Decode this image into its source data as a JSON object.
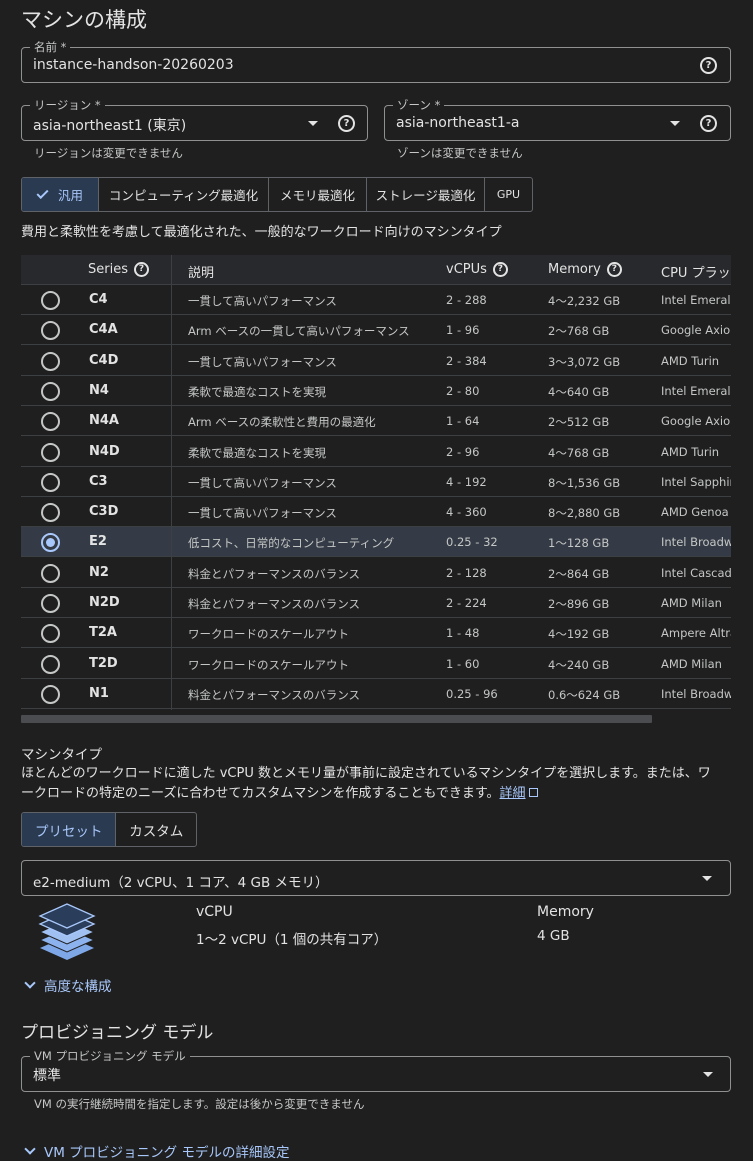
{
  "page": {
    "title": "マシンの構成"
  },
  "name_field": {
    "label": "名前 *",
    "value": "instance-handson-20260203"
  },
  "region_field": {
    "label": "リージョン *",
    "value": "asia-northeast1 (東京)",
    "hint": "リージョンは変更できません"
  },
  "zone_field": {
    "label": "ゾーン *",
    "value": "asia-northeast1-a",
    "hint": "ゾーンは変更できません"
  },
  "family_tabs": {
    "items": [
      {
        "label": "汎用",
        "selected": true
      },
      {
        "label": "コンピューティング最適化",
        "selected": false
      },
      {
        "label": "メモリ最適化",
        "selected": false
      },
      {
        "label": "ストレージ最適化",
        "selected": false
      },
      {
        "label": "GPU",
        "selected": false
      }
    ],
    "description": "費用と柔軟性を考慮して最適化された、一般的なワークロード向けのマシンタイプ"
  },
  "series_table": {
    "columns": [
      "Series",
      "説明",
      "vCPUs",
      "Memory",
      "CPU プラットフォーム"
    ],
    "rows": [
      {
        "series": "C4",
        "description": "一貫して高いパフォーマンス",
        "vcpus": "2 - 288",
        "memory": "4～2,232 GB",
        "cpu": "Intel Emerald Rapids",
        "selected": false
      },
      {
        "series": "C4A",
        "description": "Arm ベースの一貫して高いパフォーマンス",
        "vcpus": "1 - 96",
        "memory": "2～768 GB",
        "cpu": "Google Axion",
        "selected": false
      },
      {
        "series": "C4D",
        "description": "一貫して高いパフォーマンス",
        "vcpus": "2 - 384",
        "memory": "3～3,072 GB",
        "cpu": "AMD Turin",
        "selected": false
      },
      {
        "series": "N4",
        "description": "柔軟で最適なコストを実現",
        "vcpus": "2 - 80",
        "memory": "4～640 GB",
        "cpu": "Intel Emerald Rapids",
        "selected": false
      },
      {
        "series": "N4A",
        "description": "Arm ベースの柔軟性と費用の最適化",
        "vcpus": "1 - 64",
        "memory": "2～512 GB",
        "cpu": "Google Axion",
        "selected": false
      },
      {
        "series": "N4D",
        "description": "柔軟で最適なコストを実現",
        "vcpus": "2 - 96",
        "memory": "4～768 GB",
        "cpu": "AMD Turin",
        "selected": false
      },
      {
        "series": "C3",
        "description": "一貫して高いパフォーマンス",
        "vcpus": "4 - 192",
        "memory": "8～1,536 GB",
        "cpu": "Intel Sapphire Rapids",
        "selected": false
      },
      {
        "series": "C3D",
        "description": "一貫して高いパフォーマンス",
        "vcpus": "4 - 360",
        "memory": "8～2,880 GB",
        "cpu": "AMD Genoa",
        "selected": false
      },
      {
        "series": "E2",
        "description": "低コスト、日常的なコンピューティング",
        "vcpus": "0.25 - 32",
        "memory": "1～128 GB",
        "cpu": "Intel Broadwell",
        "selected": true
      },
      {
        "series": "N2",
        "description": "料金とパフォーマンスのバランス",
        "vcpus": "2 - 128",
        "memory": "2～864 GB",
        "cpu": "Intel Cascade Lake",
        "selected": false
      },
      {
        "series": "N2D",
        "description": "料金とパフォーマンスのバランス",
        "vcpus": "2 - 224",
        "memory": "2～896 GB",
        "cpu": "AMD Milan",
        "selected": false
      },
      {
        "series": "T2A",
        "description": "ワークロードのスケールアウト",
        "vcpus": "1 - 48",
        "memory": "4～192 GB",
        "cpu": "Ampere Altra",
        "selected": false
      },
      {
        "series": "T2D",
        "description": "ワークロードのスケールアウト",
        "vcpus": "1 - 60",
        "memory": "4～240 GB",
        "cpu": "AMD Milan",
        "selected": false
      },
      {
        "series": "N1",
        "description": "料金とパフォーマンスのバランス",
        "vcpus": "0.25 - 96",
        "memory": "0.6～624 GB",
        "cpu": "Intel Broadwell",
        "selected": false
      }
    ]
  },
  "machine_type": {
    "heading": "マシンタイプ",
    "description": "ほとんどのワークロードに適した vCPU 数とメモリ量が事前に設定されているマシンタイプを選択します。または、ワークロードの特定のニーズに合わせてカスタムマシンを作成することもできます。",
    "link_label": "詳細",
    "tabs": [
      {
        "label": "プリセット",
        "selected": true
      },
      {
        "label": "カスタム",
        "selected": false
      }
    ],
    "select_value": "e2-medium（2 vCPU、1 コア、4 GB メモリ）",
    "vcpu_heading": "vCPU",
    "vcpu_value": "1～2 vCPU（1 個の共有コア）",
    "memory_heading": "Memory",
    "memory_value": "4 GB",
    "advanced_label": "高度な構成"
  },
  "provisioning": {
    "heading": "プロビジョニング モデル",
    "field_label": "VM プロビジョニング モデル",
    "field_value": "標準",
    "hint": "VM の実行継続時間を指定します。設定は後から変更できません",
    "advanced_label": "VM プロビジョニング モデルの詳細設定"
  },
  "colors": {
    "background": "#1f1f1f",
    "accent": "#a8c7fa",
    "selected_bg": "#293a51"
  }
}
